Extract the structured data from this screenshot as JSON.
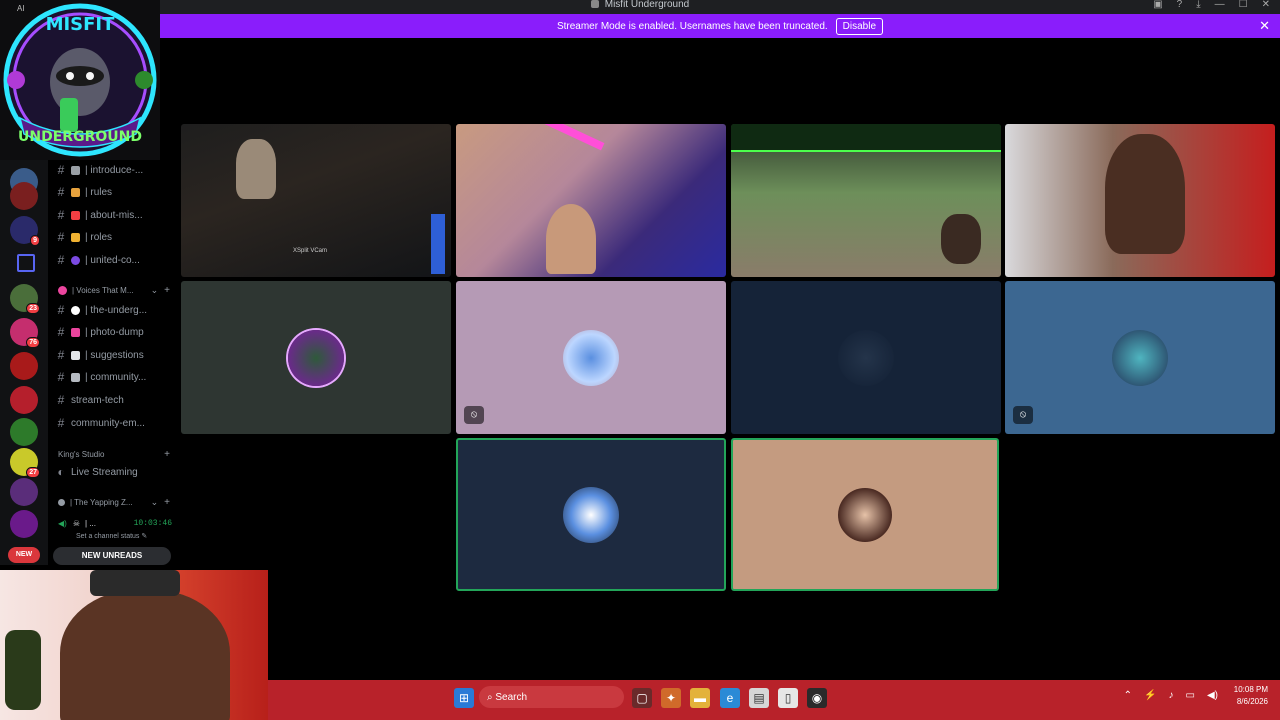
{
  "window": {
    "title": "Misfit Underground",
    "ai_label": "AI",
    "controls": [
      "▣",
      "?",
      "⤓",
      "—",
      "☐",
      "✕"
    ]
  },
  "banner": {
    "text": "Streamer Mode is enabled. Usernames have been truncated.",
    "button": "Disable",
    "close": "✕"
  },
  "logo": {
    "line1": "MISFIT",
    "line2": "UNDERGROUND"
  },
  "guild_badges": [
    "9",
    "23",
    "76",
    "27"
  ],
  "new_pill": "NEW",
  "channels": [
    {
      "name": "| introduce-...",
      "emoji_color": "#9aa0a6"
    },
    {
      "name": "| rules",
      "emoji_color": "#e7a33e"
    },
    {
      "name": "| about-mis...",
      "emoji_color": "#f23f43"
    },
    {
      "name": "| roles",
      "emoji_color": "#f0b232"
    },
    {
      "name": "| united-co...",
      "emoji_color": "#7b4ae2"
    }
  ],
  "category_voices": "| Voices That M...",
  "channels2": [
    {
      "name": "| the-underg...",
      "emoji_color": "#ffffff"
    },
    {
      "name": "| photo-dump",
      "emoji_color": "#eb459e"
    },
    {
      "name": "| suggestions",
      "emoji_color": "#e3e5e8"
    },
    {
      "name": "| community...",
      "emoji_color": "#b5bac1"
    },
    {
      "name": "stream-tech",
      "emoji_color": ""
    },
    {
      "name": "community-em...",
      "emoji_color": ""
    }
  ],
  "category_kings": "King's Studio",
  "live_streaming": "Live Streaming",
  "category_yapping": "| The Yapping Z...",
  "voice_user": {
    "name": "| ...",
    "time": "10:03:46"
  },
  "channel_status": "Set a channel status",
  "new_unreads": "NEW UNREADS",
  "cam_label": "XSplit VCam",
  "taskbar": {
    "search": "Search",
    "time": "10:08 PM",
    "date": "8/6/2026"
  },
  "colors": {
    "banner": "#8a1dfb",
    "speaking": "#23a559",
    "taskbar": "#b8222a"
  }
}
